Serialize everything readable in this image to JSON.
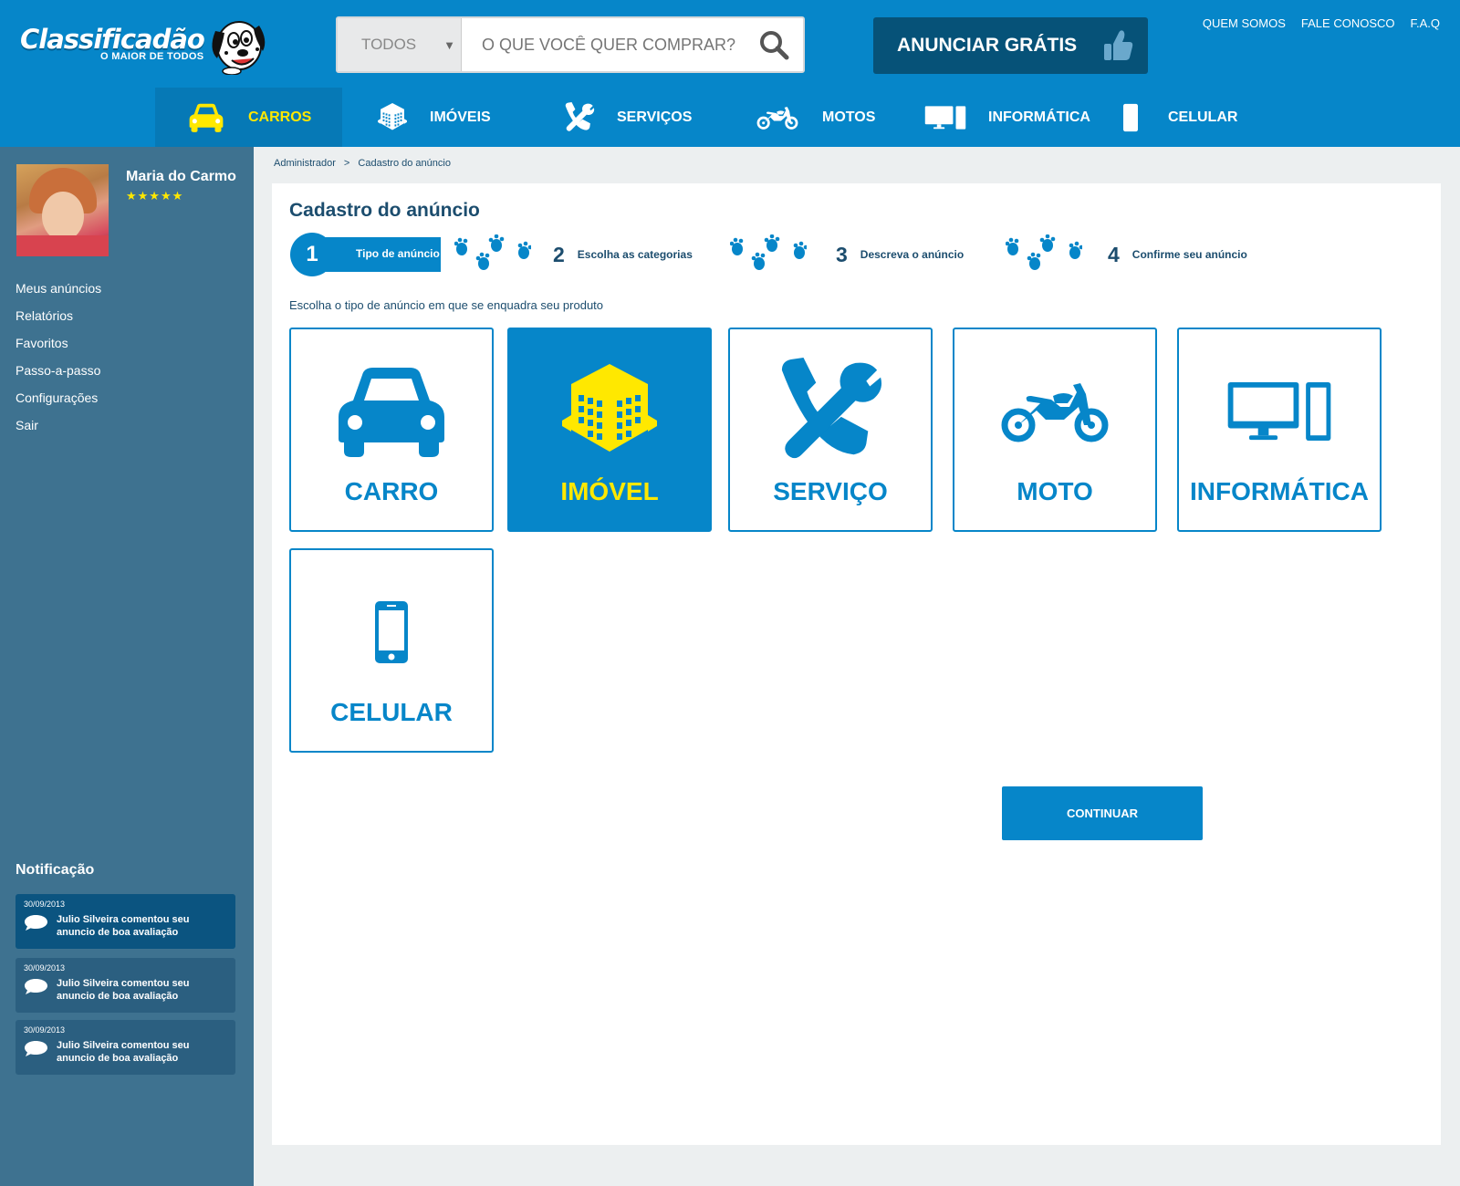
{
  "brand": {
    "name": "Classificadão",
    "tagline": "O MAIOR DE TODOS"
  },
  "search": {
    "category": "TODOS",
    "placeholder": "O QUE VOCÊ QUER COMPRAR?",
    "icon": "search-icon"
  },
  "announce": {
    "label": "ANUNCIAR GRÁTIS",
    "icon": "thumbs-up-icon"
  },
  "top_links": [
    "QUEM SOMOS",
    "FALE CONOSCO",
    "F.A.Q"
  ],
  "nav": [
    {
      "label": "CARROS",
      "icon": "car-icon",
      "active": true
    },
    {
      "label": "IMÓVEIS",
      "icon": "building-icon",
      "active": false
    },
    {
      "label": "SERVIÇOS",
      "icon": "tools-icon",
      "active": false
    },
    {
      "label": "MOTOS",
      "icon": "motorcycle-icon",
      "active": false
    },
    {
      "label": "INFORMÁTICA",
      "icon": "computer-icon",
      "active": false
    },
    {
      "label": "CELULAR",
      "icon": "phone-icon",
      "active": false
    }
  ],
  "user": {
    "name": "Maria do Carmo",
    "rating": 5,
    "stars": "★★★★★"
  },
  "sidebar_menu": [
    "Meus anúncios",
    "Relatórios",
    "Favoritos",
    "Passo-a-passo",
    "Configurações",
    "Sair"
  ],
  "notifications": {
    "title": "Notificação",
    "items": [
      {
        "date": "30/09/2013",
        "text": "Julio Silveira comentou seu anuncio de boa avaliação",
        "highlighted": true
      },
      {
        "date": "30/09/2013",
        "text": "Julio Silveira comentou seu anuncio de boa avaliação",
        "highlighted": false
      },
      {
        "date": "30/09/2013",
        "text": "Julio Silveira comentou seu anuncio de boa avaliação",
        "highlighted": false
      }
    ]
  },
  "breadcrumb": [
    "Administrador",
    ">",
    "Cadastro do anúncio"
  ],
  "page": {
    "title": "Cadastro do anúncio",
    "steps": [
      {
        "number": "1",
        "label": "Tipo de anúncio",
        "active": true
      },
      {
        "number": "2",
        "label": "Escolha as categorias",
        "active": false
      },
      {
        "number": "3",
        "label": "Descreva o anúncio",
        "active": false
      },
      {
        "number": "4",
        "label": "Confirme seu anúncio",
        "active": false
      }
    ],
    "instruction": "Escolha o tipo de anúncio em que se enquadra seu produto",
    "cards": [
      {
        "label": "CARRO",
        "icon": "car-icon",
        "selected": false
      },
      {
        "label": "IMÓVEL",
        "icon": "building-icon",
        "selected": true
      },
      {
        "label": "SERVIÇO",
        "icon": "tools-icon",
        "selected": false
      },
      {
        "label": "MOTO",
        "icon": "motorcycle-icon",
        "selected": false
      },
      {
        "label": "INFORMÁTICA",
        "icon": "computer-icon",
        "selected": false
      },
      {
        "label": "CELULAR",
        "icon": "phone-icon",
        "selected": false
      }
    ],
    "continue_label": "CONTINUAR"
  },
  "colors": {
    "primary": "#0686c9",
    "dark": "#065278",
    "accent": "#ffe800",
    "sidebar": "#3e7290",
    "text": "#1c4d6e"
  }
}
